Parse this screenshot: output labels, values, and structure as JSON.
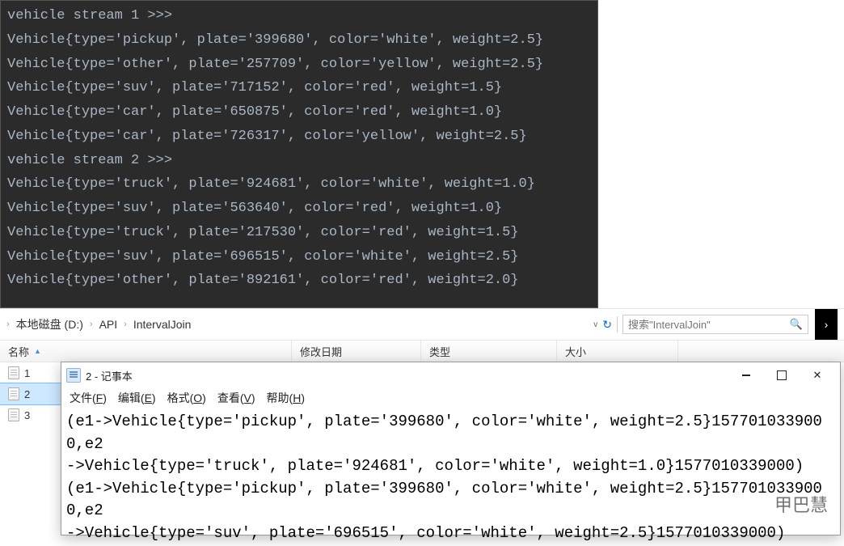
{
  "console": {
    "lines": [
      "vehicle stream 1 >>>",
      "Vehicle{type='pickup', plate='399680', color='white', weight=2.5}",
      "Vehicle{type='other', plate='257709', color='yellow', weight=2.5}",
      "Vehicle{type='suv', plate='717152', color='red', weight=1.5}",
      "Vehicle{type='car', plate='650875', color='red', weight=1.0}",
      "Vehicle{type='car', plate='726317', color='yellow', weight=2.5}",
      "vehicle stream 2 >>>",
      "Vehicle{type='truck', plate='924681', color='white', weight=1.0}",
      "Vehicle{type='suv', plate='563640', color='red', weight=1.0}",
      "Vehicle{type='truck', plate='217530', color='red', weight=1.5}",
      "Vehicle{type='suv', plate='696515', color='white', weight=2.5}",
      "Vehicle{type='other', plate='892161', color='red', weight=2.0}"
    ]
  },
  "explorer": {
    "breadcrumb": {
      "seg1": "本地磁盘 (D:)",
      "seg2": "API",
      "seg3": "IntervalJoin"
    },
    "search_placeholder": "搜索\"IntervalJoin\"",
    "columns": {
      "name": "名称",
      "modified": "修改日期",
      "type": "类型",
      "size": "大小"
    },
    "files": [
      "1",
      "2",
      "3"
    ],
    "selected_index": 1
  },
  "notepad": {
    "title": "2 - 记事本",
    "menu": {
      "file": "文件(F)",
      "edit": "编辑(E)",
      "format": "格式(O)",
      "view": "查看(V)",
      "help": "帮助(H)"
    },
    "content_lines": [
      "(e1->Vehicle{type='pickup', plate='399680', color='white', weight=2.5}1577010339000,e2",
      "->Vehicle{type='truck', plate='924681', color='white', weight=1.0}1577010339000)",
      "(e1->Vehicle{type='pickup', plate='399680', color='white', weight=2.5}1577010339000,e2",
      "->Vehicle{type='suv', plate='696515', color='white', weight=2.5}1577010339000)"
    ]
  },
  "watermark": "甲巴慧"
}
